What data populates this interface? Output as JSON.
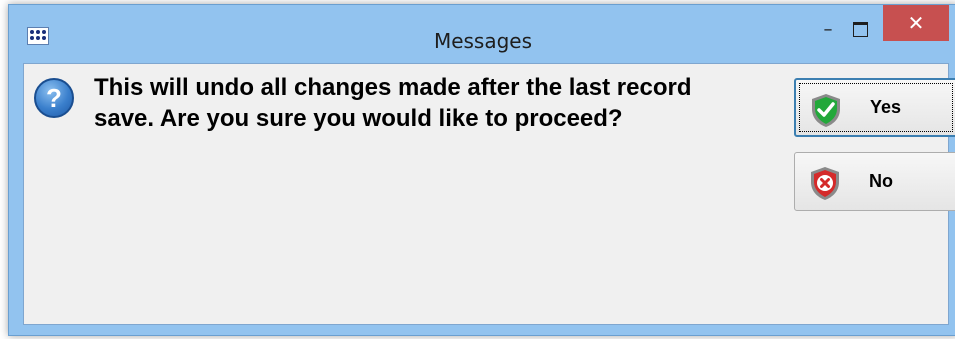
{
  "window": {
    "title": "Messages"
  },
  "controls": {
    "minimize": "–",
    "close": "✕"
  },
  "dialog": {
    "icon": "question-icon",
    "icon_glyph": "?",
    "message": "This will undo all changes made after the last record save. Are you sure you would like to proceed?"
  },
  "buttons": {
    "yes_label": "Yes",
    "no_label": "No"
  },
  "colors": {
    "titlebar": "#92c3ef",
    "close_button": "#c75050",
    "content_bg": "#f0f0f0",
    "yes_shield": "#22a83a",
    "no_shield": "#d42a2a"
  }
}
